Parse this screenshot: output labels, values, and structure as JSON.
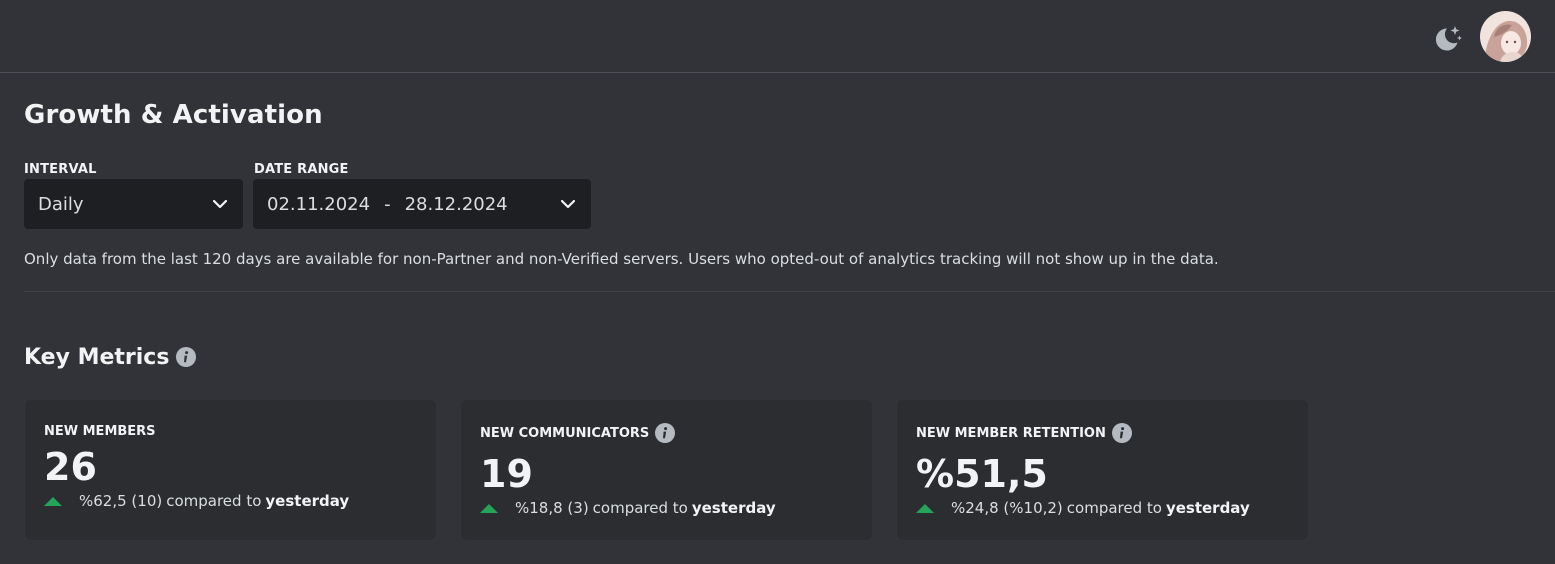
{
  "header": {
    "theme_icon": "moon-sparkle-icon",
    "avatar_icon": "user-avatar"
  },
  "page": {
    "title": "Growth & Activation"
  },
  "filters": {
    "interval": {
      "label": "INTERVAL",
      "value": "Daily"
    },
    "date_range": {
      "label": "DATE RANGE",
      "start": "02.11.2024",
      "separator": "-",
      "end": "28.12.2024"
    }
  },
  "disclaimer": "Only data from the last 120 days are available for non-Partner and non-Verified servers. Users who opted-out of analytics tracking will not show up in the data.",
  "key_metrics": {
    "title": "Key Metrics",
    "comparison_text": "compared to",
    "comparison_period": "yesterday",
    "cards": [
      {
        "label": "NEW MEMBERS",
        "value": "26",
        "change": "%62,5 (10)",
        "trend": "up",
        "has_info": false
      },
      {
        "label": "NEW COMMUNICATORS",
        "value": "19",
        "change": "%18,8 (3)",
        "trend": "up",
        "has_info": true
      },
      {
        "label": "NEW MEMBER RETENTION",
        "value": "%51,5",
        "change": "%24,8 (%10,2)",
        "trend": "up",
        "has_info": true
      }
    ]
  },
  "colors": {
    "background": "#313338",
    "card": "#2b2d31",
    "input": "#1e1f22",
    "trend_up": "#23a559"
  }
}
